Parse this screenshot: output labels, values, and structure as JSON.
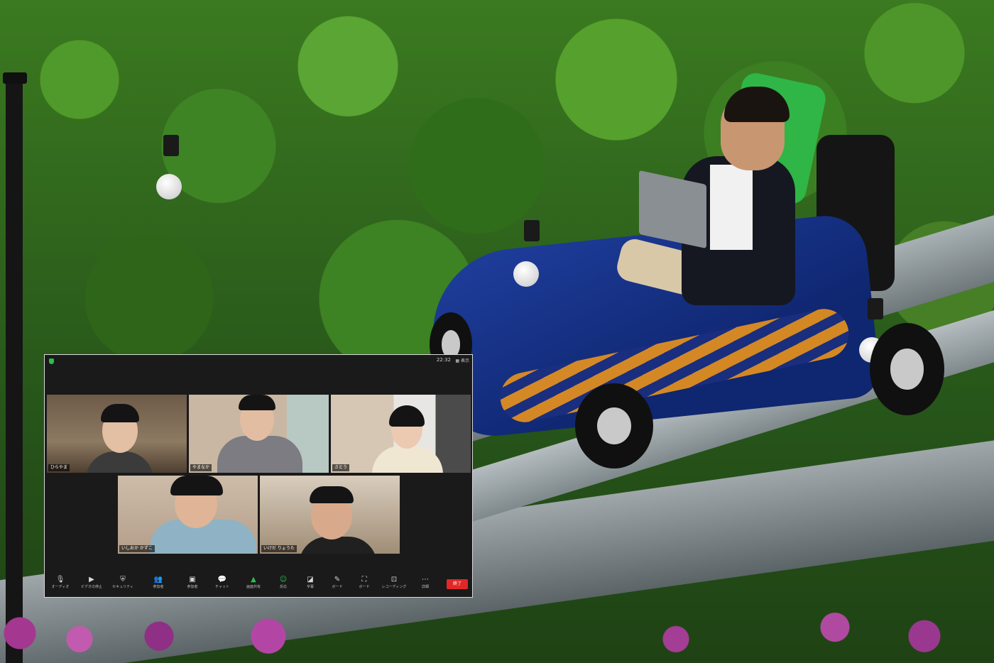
{
  "meeting": {
    "time": "22:32",
    "view_label": "表示",
    "participants": [
      {
        "name": "ひらやま"
      },
      {
        "name": "やまなか"
      },
      {
        "name": "さとう"
      },
      {
        "name": "いしおか かずこ"
      },
      {
        "name": "いけだ りょうた"
      }
    ],
    "toolbar": [
      {
        "label": "オーディオ",
        "icon": "microphone-icon"
      },
      {
        "label": "ビデオの停止",
        "icon": "video-camera-icon"
      },
      {
        "label": "セキュリティ",
        "icon": "shield-icon"
      },
      {
        "label": "参加者",
        "icon": "participants-icon"
      },
      {
        "label": "参加者",
        "icon": "chat-bubble-icon"
      },
      {
        "label": "チャット",
        "icon": "chat-icon"
      },
      {
        "label": "画面共有",
        "icon": "share-screen-icon"
      },
      {
        "label": "反応",
        "icon": "emoji-icon"
      },
      {
        "label": "字幕",
        "icon": "captions-icon"
      },
      {
        "label": "ボード",
        "icon": "whiteboard-icon"
      },
      {
        "label": "ボード",
        "icon": "apps-icon"
      },
      {
        "label": "レコーディング",
        "icon": "record-icon"
      },
      {
        "label": "詳細",
        "icon": "more-icon"
      }
    ],
    "end_label": "終了",
    "colors": {
      "end": "#e02828",
      "accent": "#2bbf4d"
    }
  }
}
